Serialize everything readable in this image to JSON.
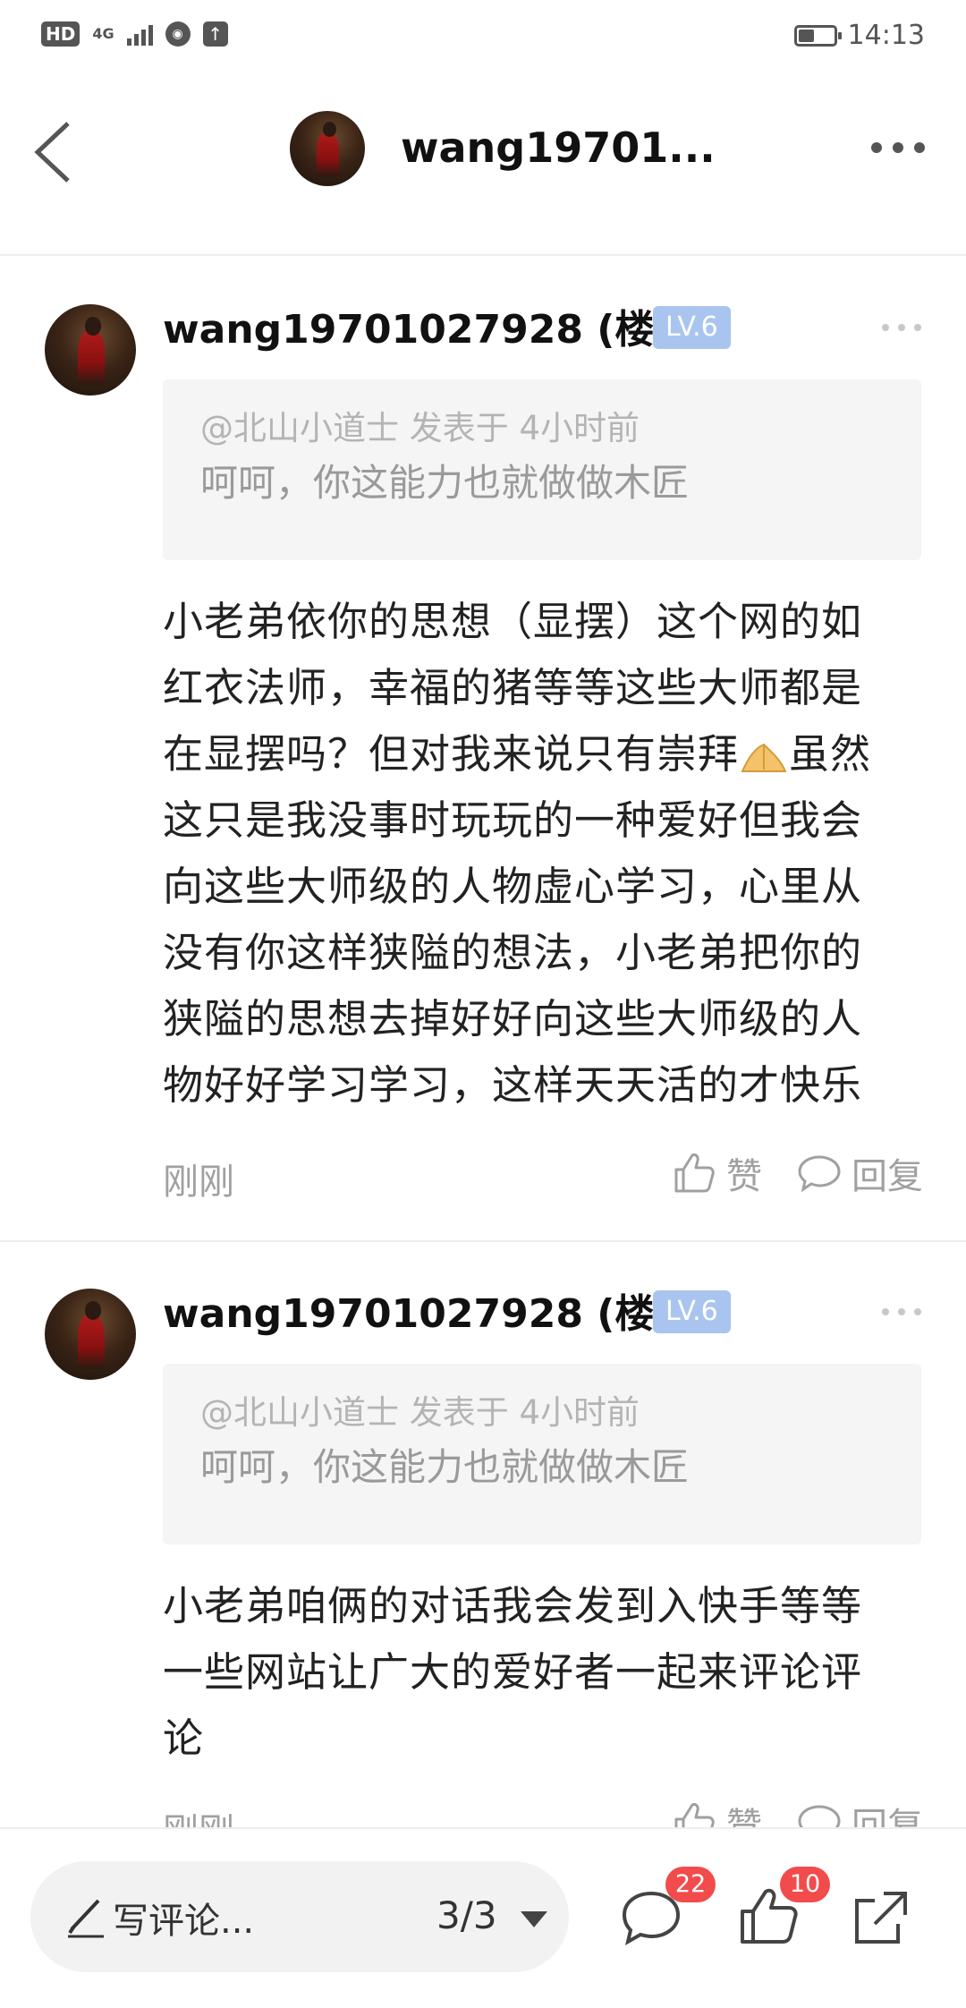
{
  "status_bar": {
    "hd": "HD",
    "network": "4G",
    "time": "14:13",
    "battery_level": 0.45
  },
  "header": {
    "title": "wang19701...",
    "avatar_icon": "user-avatar-photo"
  },
  "comments": [
    {
      "username": "wang19701027928 (楼...",
      "level": "LV.6",
      "quote_meta": "@北山小道士 发表于 4小时前",
      "quote_text": "呵呵，你这能力也就做做木匠",
      "body_lines": [
        "小老弟依你的思想（显摆）这个网的如",
        "红衣法师，幸福的猪等等这些大师都是",
        "在显摆吗？但对我来说只有崇拜",
        "这只是我没事时玩玩的一种爱好但我会",
        "向这些大师级的人物虚心学习，心里从",
        "没有你这样狭隘的想法，小老弟把你的",
        "狭隘的思想去掉好好向这些大师级的人",
        "物好好学习学习，这样天天活的才快乐"
      ],
      "body_line3_after_emoji": "虽然",
      "time": "刚刚",
      "like_label": "赞",
      "reply_label": "回复"
    },
    {
      "username": "wang19701027928 (楼...",
      "level": "LV.6",
      "quote_meta": "@北山小道士 发表于 4小时前",
      "quote_text": "呵呵，你这能力也就做做木匠",
      "body_lines": [
        "小老弟咱俩的对话我会发到入快手等等",
        "一些网站让广大的爱好者一起来评论评",
        "论"
      ],
      "time": "刚刚",
      "like_label": "赞",
      "reply_label": "回复"
    }
  ],
  "bottom_bar": {
    "comment_placeholder": "写评论...",
    "page_indicator": "3/3",
    "comment_count": "22",
    "like_count": "10",
    "icons": [
      "pencil-icon",
      "comment-icon",
      "thumbs-up-icon",
      "share-icon"
    ]
  },
  "colors": {
    "level_badge": "#a9c5ef",
    "notification_badge": "#f24b4b",
    "quote_bg": "#f5f5f5"
  }
}
